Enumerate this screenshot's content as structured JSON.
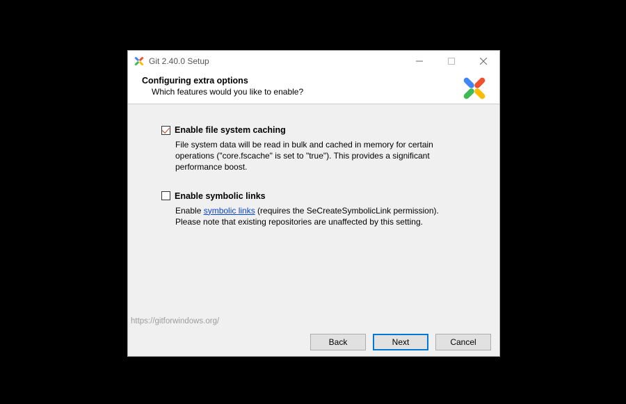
{
  "window": {
    "title": "Git 2.40.0 Setup"
  },
  "header": {
    "heading": "Configuring extra options",
    "subheading": "Which features would you like to enable?"
  },
  "options": {
    "fscache": {
      "label": "Enable file system caching",
      "checked": true,
      "desc": "File system data will be read in bulk and cached in memory for certain operations (\"core.fscache\" is set to \"true\"). This provides a significant performance boost."
    },
    "symlinks": {
      "label": "Enable symbolic links",
      "checked": false,
      "desc_pre": "Enable ",
      "desc_link": "symbolic links",
      "desc_post": " (requires the SeCreateSymbolicLink permission). Please note that existing repositories are unaffected by this setting."
    }
  },
  "footer": {
    "url": "https://gitforwindows.org/",
    "back": "Back",
    "next": "Next",
    "cancel": "Cancel"
  }
}
